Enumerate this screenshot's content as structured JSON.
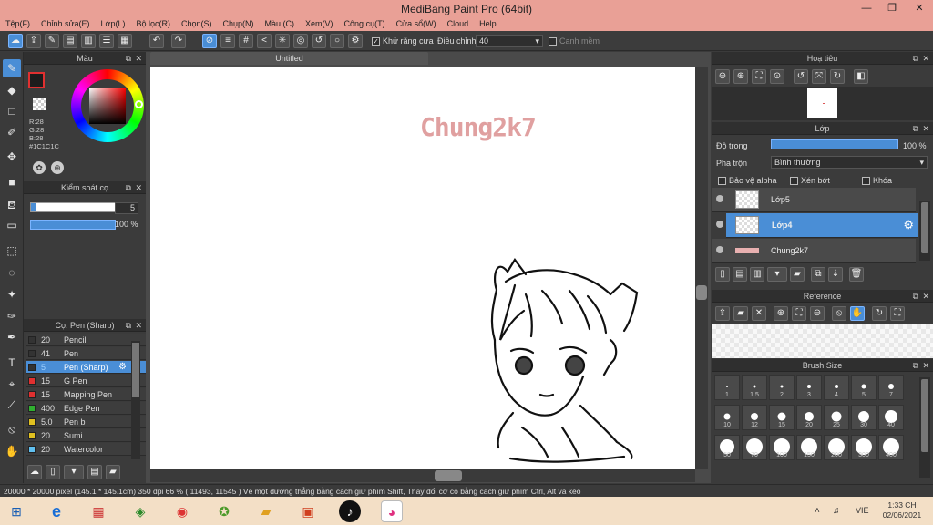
{
  "window": {
    "title": "MediBang Paint Pro (64bit)"
  },
  "menu": [
    "Tệp(F)",
    "Chỉnh sửa(E)",
    "Lớp(L)",
    "Bộ lọc(R)",
    "Chọn(S)",
    "Chụp(N)",
    "Màu (C)",
    "Xem(V)",
    "Công cụ(T)",
    "Cửa sổ(W)",
    "Cloud",
    "Help"
  ],
  "toolbar": {
    "antialias_label": "Khử răng cưa",
    "adjust_label": "Điều chỉnh",
    "adjust_value": "40",
    "snap_label": "Canh mềm"
  },
  "color_panel": {
    "title": "Màu",
    "r": "R:28",
    "g": "G:28",
    "b": "B:28",
    "hex": "#1C1C1C",
    "fg_color": "#1c1c1c",
    "bg_color": "#ffffff"
  },
  "size_panel": {
    "title": "Kiểm soát cọ",
    "size_value": "5",
    "opacity_value": "100 %"
  },
  "brush_panel": {
    "title": "Cọ: Pen (Sharp)",
    "items": [
      {
        "size": "20",
        "name": "Pencil",
        "color": "#333333"
      },
      {
        "size": "41",
        "name": "Pen",
        "color": "#333333"
      },
      {
        "size": "5",
        "name": "Pen (Sharp)",
        "color": "#333333",
        "selected": true
      },
      {
        "size": "15",
        "name": "G Pen",
        "color": "#e03030"
      },
      {
        "size": "15",
        "name": "Mapping Pen",
        "color": "#e03030"
      },
      {
        "size": "400",
        "name": "Edge Pen",
        "color": "#30b030"
      },
      {
        "size": "5.0",
        "name": "Pen b",
        "color": "#e0c020"
      },
      {
        "size": "20",
        "name": "Sumi",
        "color": "#e0c020"
      },
      {
        "size": "20",
        "name": "Watercolor",
        "color": "#60c0f0"
      }
    ]
  },
  "document": {
    "tab_title": "Untitled",
    "watermark_text": "Chung2k7"
  },
  "navigator_panel": {
    "title": "Hoạ tiêu"
  },
  "layer_panel": {
    "title": "Lớp",
    "opacity_label": "Độ trong",
    "opacity_value": "100 %",
    "blend_label": "Pha trộn",
    "blend_value": "Bình thường",
    "protect_alpha": "Bảo vệ alpha",
    "clipping": "Xén bớt",
    "lock": "Khóa",
    "layers": [
      {
        "name": "Lớp5",
        "selected": false
      },
      {
        "name": "Lớp4",
        "selected": true
      },
      {
        "name": "Chung2k7",
        "selected": false
      }
    ]
  },
  "reference_panel": {
    "title": "Reference"
  },
  "brush_size_panel": {
    "title": "Brush Size",
    "sizes": [
      "1",
      "1.5",
      "2",
      "3",
      "4",
      "5",
      "7",
      "10",
      "12",
      "15",
      "20",
      "25",
      "30",
      "40",
      "50",
      "70",
      "100",
      "150",
      "200",
      "300",
      "400"
    ]
  },
  "status": {
    "text": "20000 * 20000 pixel   (145.1 * 145.1cm)   350 dpi   66 %   ( 11493, 11545 )   Vẽ một đường thẳng bằng cách giữ phím Shift, Thay đổi cỡ cọ bằng cách giữ phím Ctrl, Alt và kéo"
  },
  "taskbar": {
    "lang": "VIE",
    "time": "1:33 CH",
    "date": "02/06/2021"
  }
}
